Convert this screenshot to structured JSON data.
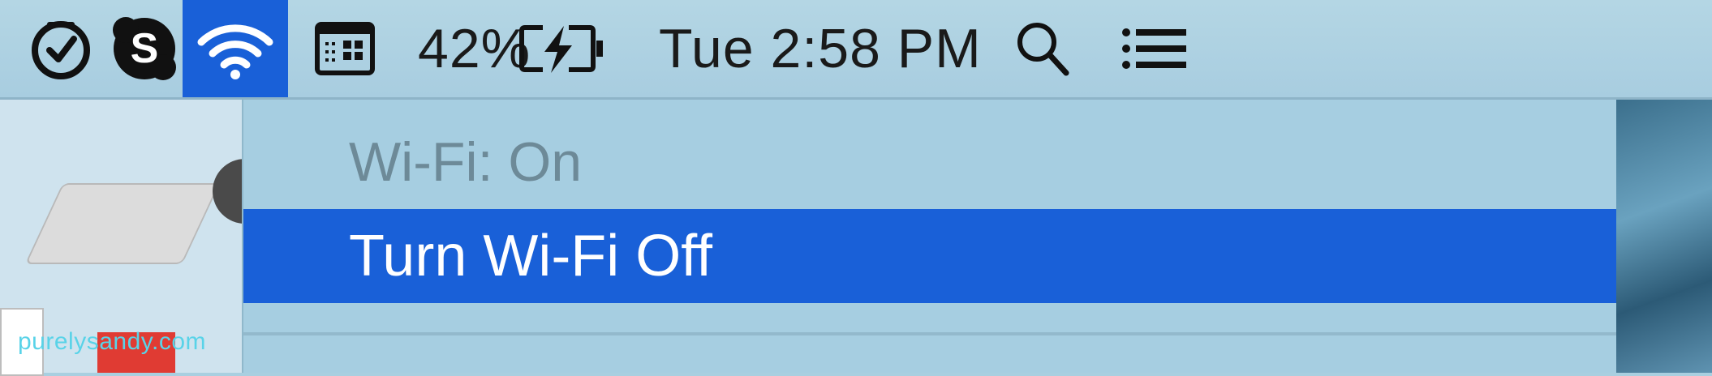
{
  "menubar": {
    "status_icons": [
      "clock-check-icon",
      "skype-icon",
      "wifi-icon",
      "app-window-icon"
    ],
    "battery": {
      "percent_text": "42%",
      "state": "charging",
      "icon": "battery-charging-icon"
    },
    "clock": "Tue 2:58 PM",
    "right_icons": [
      "search-icon",
      "notification-list-icon"
    ]
  },
  "wifi_menu": {
    "status": "Wi-Fi: On",
    "toggle_label": "Turn Wi-Fi Off"
  },
  "watermark": "purelysandy.com",
  "colors": {
    "menubar": "#aacfe0",
    "highlight": "#1960d8",
    "menu_text_disabled": "#6d8a98",
    "menu_text_selected": "#ffffff"
  }
}
